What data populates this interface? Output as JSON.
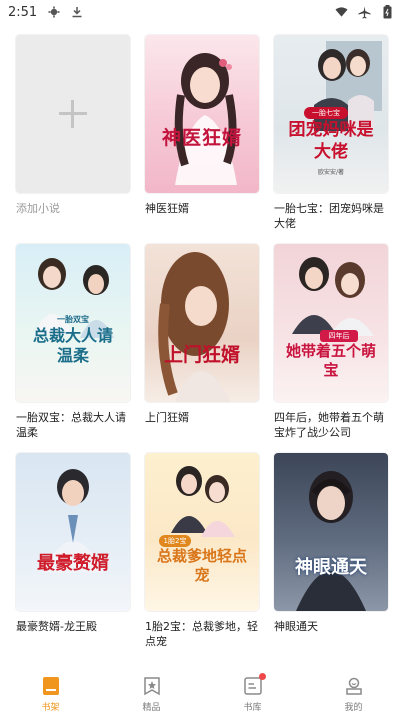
{
  "status_bar": {
    "time": "2:51"
  },
  "add_book": {
    "label": "添加小说"
  },
  "books": [
    {
      "title": "神医狂婿",
      "cover_title": "神医狂婿",
      "cover_author": ""
    },
    {
      "title": "一胎七宝：团宠妈咪是大佬",
      "cover_title": "团宠妈咪是大佬",
      "cover_subtitle": "一胎七宝",
      "cover_author": "欧安安/著"
    },
    {
      "title": "一胎双宝：总裁大人请温柔",
      "cover_title": "总裁大人请温柔",
      "cover_subtitle": "一胎双宝",
      "cover_author": ""
    },
    {
      "title": "上门狂婿",
      "cover_title": "上门狂婿",
      "cover_author": ""
    },
    {
      "title": "四年后，她带着五个萌宝炸了战少公司",
      "cover_title": "她带着五个萌宝",
      "cover_subtitle": "四年后",
      "cover_author": ""
    },
    {
      "title": "最豪赘婿-龙王殿",
      "cover_title": "最豪赘婿",
      "cover_author": ""
    },
    {
      "title": "1胎2宝：总裁爹地，轻点宠",
      "cover_title": "总裁爹地轻点宠",
      "cover_subtitle": "1胎2宝",
      "cover_author": ""
    },
    {
      "title": "神眼通天",
      "cover_title": "神眼通天",
      "cover_author": ""
    }
  ],
  "bottom_nav": [
    {
      "label": "书架",
      "icon": "bookshelf-icon",
      "active": true
    },
    {
      "label": "精品",
      "icon": "premium-icon",
      "active": false
    },
    {
      "label": "书库",
      "icon": "library-icon",
      "active": false,
      "badge": true
    },
    {
      "label": "我的",
      "icon": "profile-icon",
      "active": false
    }
  ],
  "colors": {
    "accent": "#f0961e",
    "badge": "#f04848"
  }
}
